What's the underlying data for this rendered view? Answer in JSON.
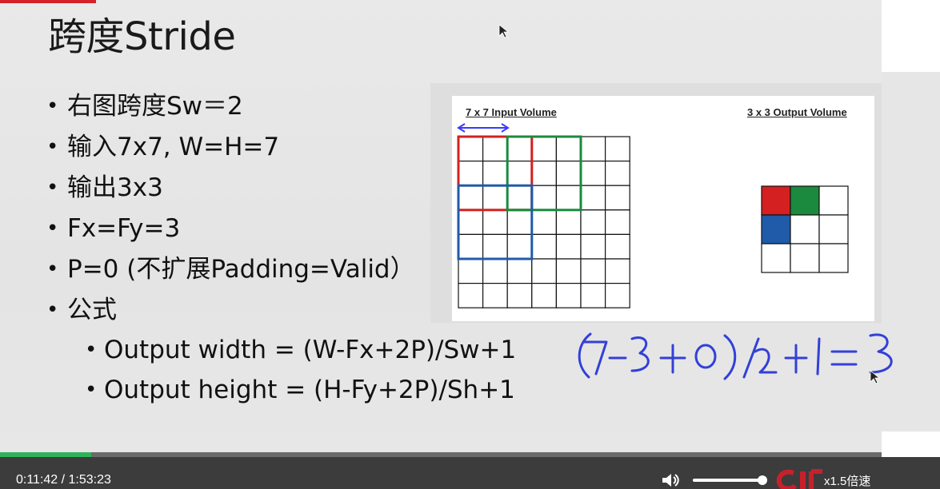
{
  "slide": {
    "title": "跨度Stride",
    "bullets": [
      "右图跨度Sw＝2",
      "输入7x7, W=H=7",
      "输出3x3",
      "Fx=Fy=3",
      "P=0 (不扩展Padding=Valid）",
      "公式"
    ],
    "formula_bullets": [
      "Output width = (W-Fx+2P)/Sw+1",
      "Output height = (H-Fy+2P)/Sh+1"
    ]
  },
  "figure": {
    "input_label": "7 x 7 Input Volume",
    "output_label": "3 x 3 Output Volume",
    "input_grid_size": 7,
    "output_grid_size": 3,
    "filter_size": 3,
    "stride": 2,
    "colors": {
      "red": "#d42020",
      "green": "#1b8a3e",
      "blue": "#1f5ba8",
      "arrow": "#3a3aff"
    }
  },
  "handwriting": {
    "text": "(7-3+0)/2+1=3",
    "color": "#3340d8"
  },
  "player": {
    "time_display": "0:11:42 / 1:53:23",
    "speed_label": "x1.5倍速",
    "played_fraction": 0.103,
    "volume_fraction": 0.97,
    "volume_icon": "speaker-icon"
  }
}
